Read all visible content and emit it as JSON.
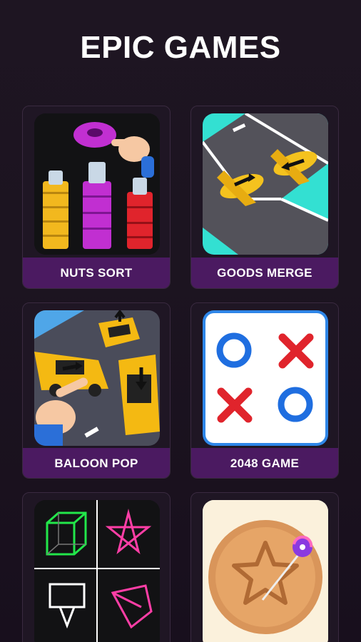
{
  "header": {
    "title": "EPIC GAMES"
  },
  "games": [
    {
      "label": "NUTS SORT",
      "icon": "nuts-sort-icon"
    },
    {
      "label": "GOODS MERGE",
      "icon": "planes-merge-icon"
    },
    {
      "label": "BALOON POP",
      "icon": "car-parking-icon"
    },
    {
      "label": "2048 GAME",
      "icon": "tic-tac-toe-icon"
    },
    {
      "label": "",
      "icon": "shape-drawing-icon"
    },
    {
      "label": "",
      "icon": "candy-cookie-icon"
    }
  ],
  "colors": {
    "label_bg": "#4b1a61",
    "background": "#1c1420"
  }
}
